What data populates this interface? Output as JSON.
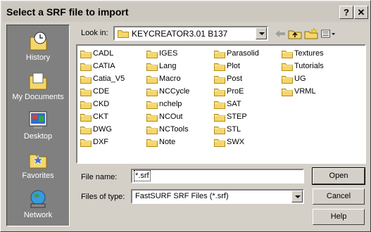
{
  "dialog": {
    "title": "Select a SRF file to import"
  },
  "titlebar": {
    "help_label": "?",
    "close_label": "✕"
  },
  "places": [
    {
      "label": "History",
      "icon": "history-icon"
    },
    {
      "label": "My Documents",
      "icon": "my-documents-icon"
    },
    {
      "label": "Desktop",
      "icon": "desktop-icon"
    },
    {
      "label": "Favorites",
      "icon": "favorites-icon"
    },
    {
      "label": "Network",
      "icon": "network-icon"
    }
  ],
  "lookin": {
    "label": "Look in:",
    "value": "KEYCREATOR3.01 B137"
  },
  "files": {
    "col1": [
      "CADL",
      "CATIA",
      "Catia_V5",
      "CDE",
      "CKD",
      "CKT",
      "DWG",
      "DXF"
    ],
    "col2": [
      "IGES",
      "Lang",
      "Macro",
      "NCCycle",
      "nchelp",
      "NCOut",
      "NCTools",
      "Note"
    ],
    "col3": [
      "Parasolid",
      "Plot",
      "Post",
      "ProE",
      "SAT",
      "STEP",
      "STL",
      "SWX"
    ],
    "col4": [
      "Textures",
      "Tutorials",
      "UG",
      "VRML"
    ]
  },
  "filename": {
    "label": "File name:",
    "value": "*.srf"
  },
  "filetype": {
    "label": "Files of type:",
    "value": "FastSURF SRF Files (*.srf)"
  },
  "buttons": {
    "open": "Open",
    "cancel": "Cancel",
    "help": "Help"
  },
  "colors": {
    "folder": "#f5d66a",
    "folder_edge": "#b08c1c",
    "panel": "#808080",
    "face": "#d4d0c8"
  }
}
